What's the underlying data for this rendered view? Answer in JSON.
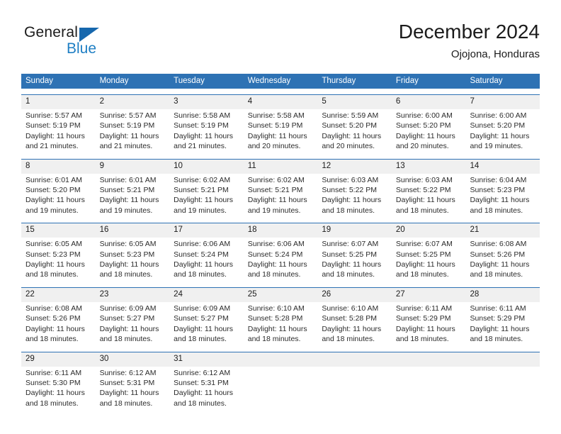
{
  "brand": {
    "name_top": "General",
    "name_bottom": "Blue",
    "accent_color": "#1f7fc4",
    "triangle_color": "#1667ad",
    "logo_icon": "triangle-logo-icon"
  },
  "header": {
    "title": "December 2024",
    "location": "Ojojona, Honduras"
  },
  "theme": {
    "header_blue": "#2e72b4",
    "band_gray": "#f0f0f0",
    "text_color": "#1b1b1b"
  },
  "calendar": {
    "weekdays": [
      "Sunday",
      "Monday",
      "Tuesday",
      "Wednesday",
      "Thursday",
      "Friday",
      "Saturday"
    ],
    "weeks": [
      [
        {
          "day": "1",
          "sunrise": "Sunrise: 5:57 AM",
          "sunset": "Sunset: 5:19 PM",
          "daylight1": "Daylight: 11 hours",
          "daylight2": "and 21 minutes."
        },
        {
          "day": "2",
          "sunrise": "Sunrise: 5:57 AM",
          "sunset": "Sunset: 5:19 PM",
          "daylight1": "Daylight: 11 hours",
          "daylight2": "and 21 minutes."
        },
        {
          "day": "3",
          "sunrise": "Sunrise: 5:58 AM",
          "sunset": "Sunset: 5:19 PM",
          "daylight1": "Daylight: 11 hours",
          "daylight2": "and 21 minutes."
        },
        {
          "day": "4",
          "sunrise": "Sunrise: 5:58 AM",
          "sunset": "Sunset: 5:19 PM",
          "daylight1": "Daylight: 11 hours",
          "daylight2": "and 20 minutes."
        },
        {
          "day": "5",
          "sunrise": "Sunrise: 5:59 AM",
          "sunset": "Sunset: 5:20 PM",
          "daylight1": "Daylight: 11 hours",
          "daylight2": "and 20 minutes."
        },
        {
          "day": "6",
          "sunrise": "Sunrise: 6:00 AM",
          "sunset": "Sunset: 5:20 PM",
          "daylight1": "Daylight: 11 hours",
          "daylight2": "and 20 minutes."
        },
        {
          "day": "7",
          "sunrise": "Sunrise: 6:00 AM",
          "sunset": "Sunset: 5:20 PM",
          "daylight1": "Daylight: 11 hours",
          "daylight2": "and 19 minutes."
        }
      ],
      [
        {
          "day": "8",
          "sunrise": "Sunrise: 6:01 AM",
          "sunset": "Sunset: 5:20 PM",
          "daylight1": "Daylight: 11 hours",
          "daylight2": "and 19 minutes."
        },
        {
          "day": "9",
          "sunrise": "Sunrise: 6:01 AM",
          "sunset": "Sunset: 5:21 PM",
          "daylight1": "Daylight: 11 hours",
          "daylight2": "and 19 minutes."
        },
        {
          "day": "10",
          "sunrise": "Sunrise: 6:02 AM",
          "sunset": "Sunset: 5:21 PM",
          "daylight1": "Daylight: 11 hours",
          "daylight2": "and 19 minutes."
        },
        {
          "day": "11",
          "sunrise": "Sunrise: 6:02 AM",
          "sunset": "Sunset: 5:21 PM",
          "daylight1": "Daylight: 11 hours",
          "daylight2": "and 19 minutes."
        },
        {
          "day": "12",
          "sunrise": "Sunrise: 6:03 AM",
          "sunset": "Sunset: 5:22 PM",
          "daylight1": "Daylight: 11 hours",
          "daylight2": "and 18 minutes."
        },
        {
          "day": "13",
          "sunrise": "Sunrise: 6:03 AM",
          "sunset": "Sunset: 5:22 PM",
          "daylight1": "Daylight: 11 hours",
          "daylight2": "and 18 minutes."
        },
        {
          "day": "14",
          "sunrise": "Sunrise: 6:04 AM",
          "sunset": "Sunset: 5:23 PM",
          "daylight1": "Daylight: 11 hours",
          "daylight2": "and 18 minutes."
        }
      ],
      [
        {
          "day": "15",
          "sunrise": "Sunrise: 6:05 AM",
          "sunset": "Sunset: 5:23 PM",
          "daylight1": "Daylight: 11 hours",
          "daylight2": "and 18 minutes."
        },
        {
          "day": "16",
          "sunrise": "Sunrise: 6:05 AM",
          "sunset": "Sunset: 5:23 PM",
          "daylight1": "Daylight: 11 hours",
          "daylight2": "and 18 minutes."
        },
        {
          "day": "17",
          "sunrise": "Sunrise: 6:06 AM",
          "sunset": "Sunset: 5:24 PM",
          "daylight1": "Daylight: 11 hours",
          "daylight2": "and 18 minutes."
        },
        {
          "day": "18",
          "sunrise": "Sunrise: 6:06 AM",
          "sunset": "Sunset: 5:24 PM",
          "daylight1": "Daylight: 11 hours",
          "daylight2": "and 18 minutes."
        },
        {
          "day": "19",
          "sunrise": "Sunrise: 6:07 AM",
          "sunset": "Sunset: 5:25 PM",
          "daylight1": "Daylight: 11 hours",
          "daylight2": "and 18 minutes."
        },
        {
          "day": "20",
          "sunrise": "Sunrise: 6:07 AM",
          "sunset": "Sunset: 5:25 PM",
          "daylight1": "Daylight: 11 hours",
          "daylight2": "and 18 minutes."
        },
        {
          "day": "21",
          "sunrise": "Sunrise: 6:08 AM",
          "sunset": "Sunset: 5:26 PM",
          "daylight1": "Daylight: 11 hours",
          "daylight2": "and 18 minutes."
        }
      ],
      [
        {
          "day": "22",
          "sunrise": "Sunrise: 6:08 AM",
          "sunset": "Sunset: 5:26 PM",
          "daylight1": "Daylight: 11 hours",
          "daylight2": "and 18 minutes."
        },
        {
          "day": "23",
          "sunrise": "Sunrise: 6:09 AM",
          "sunset": "Sunset: 5:27 PM",
          "daylight1": "Daylight: 11 hours",
          "daylight2": "and 18 minutes."
        },
        {
          "day": "24",
          "sunrise": "Sunrise: 6:09 AM",
          "sunset": "Sunset: 5:27 PM",
          "daylight1": "Daylight: 11 hours",
          "daylight2": "and 18 minutes."
        },
        {
          "day": "25",
          "sunrise": "Sunrise: 6:10 AM",
          "sunset": "Sunset: 5:28 PM",
          "daylight1": "Daylight: 11 hours",
          "daylight2": "and 18 minutes."
        },
        {
          "day": "26",
          "sunrise": "Sunrise: 6:10 AM",
          "sunset": "Sunset: 5:28 PM",
          "daylight1": "Daylight: 11 hours",
          "daylight2": "and 18 minutes."
        },
        {
          "day": "27",
          "sunrise": "Sunrise: 6:11 AM",
          "sunset": "Sunset: 5:29 PM",
          "daylight1": "Daylight: 11 hours",
          "daylight2": "and 18 minutes."
        },
        {
          "day": "28",
          "sunrise": "Sunrise: 6:11 AM",
          "sunset": "Sunset: 5:29 PM",
          "daylight1": "Daylight: 11 hours",
          "daylight2": "and 18 minutes."
        }
      ],
      [
        {
          "day": "29",
          "sunrise": "Sunrise: 6:11 AM",
          "sunset": "Sunset: 5:30 PM",
          "daylight1": "Daylight: 11 hours",
          "daylight2": "and 18 minutes."
        },
        {
          "day": "30",
          "sunrise": "Sunrise: 6:12 AM",
          "sunset": "Sunset: 5:31 PM",
          "daylight1": "Daylight: 11 hours",
          "daylight2": "and 18 minutes."
        },
        {
          "day": "31",
          "sunrise": "Sunrise: 6:12 AM",
          "sunset": "Sunset: 5:31 PM",
          "daylight1": "Daylight: 11 hours",
          "daylight2": "and 18 minutes."
        },
        {
          "day": "",
          "sunrise": "",
          "sunset": "",
          "daylight1": "",
          "daylight2": ""
        },
        {
          "day": "",
          "sunrise": "",
          "sunset": "",
          "daylight1": "",
          "daylight2": ""
        },
        {
          "day": "",
          "sunrise": "",
          "sunset": "",
          "daylight1": "",
          "daylight2": ""
        },
        {
          "day": "",
          "sunrise": "",
          "sunset": "",
          "daylight1": "",
          "daylight2": ""
        }
      ]
    ]
  }
}
